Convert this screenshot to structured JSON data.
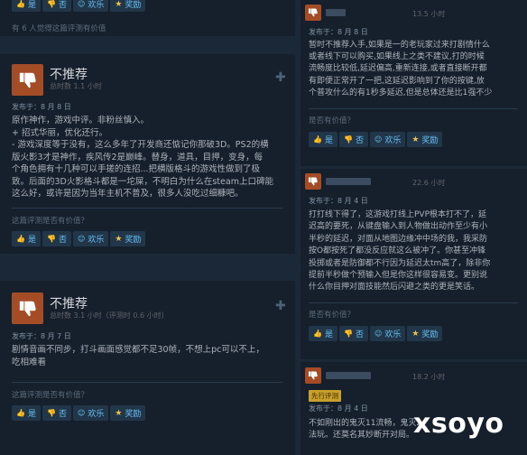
{
  "top_left": {
    "buttons": {
      "yes": "是",
      "no": "否",
      "funny": "欢乐",
      "award": "奖励"
    },
    "helpful_count": "有 6 人觉得这篇评测有价值"
  },
  "review1": {
    "verdict": "不推荐",
    "hours": "总时数 1.1 小时",
    "posted": "发布于：8 月 8 日",
    "lines": [
      "原作神作，游戏中评。非粉丝慎入。",
      "+ 招式华丽，优化还行。",
      "- 游戏深度等于没有，这么多年了开发商还惦记你那破3D。PS2的横",
      "版火影3才是神作，疾风传2是巅峰。替身，道具，目押，变身，每",
      "个角色拥有十几种可以手搓的连招...把横版格斗的游戏性做到了极",
      "致。后面的3D火影格斗都是一坨屎，不明白为什么在steam上口碑能",
      "这么好，或许是因为当年主机不普及，很多人没吃过细糠吧。"
    ],
    "question": "这篇评测是否有价值？",
    "buttons": {
      "yes": "是",
      "no": "否",
      "funny": "欢乐",
      "award": "奖励"
    }
  },
  "review2": {
    "verdict": "不推荐",
    "hours": "总时数 3.1 小时（评测时 0.6 小时）",
    "posted": "发布于：8 月 7 日",
    "lines": [
      "剧情音画不同步，打斗画面感觉都不足30帧，不想上pc可以不上，",
      "吃相难看"
    ],
    "question": "这篇评测是否有价值？",
    "buttons": {
      "yes": "是",
      "no": "否",
      "funny": "欢乐",
      "award": "奖励"
    }
  },
  "rreview1": {
    "hours": "13.5 小时",
    "posted": "发布于：8 月 8 日",
    "lines": [
      "暂时不推荐入手,如果是一的老玩家过来打剧情什么",
      "或者线下可以购买,如果线上之类不建议,打的时候",
      "流畅度比较低,延迟偏高,重新连接,或者直接断开都",
      "有即便正常开了一把,这延迟影响到了你的按键,放",
      "个普攻什么的有1秒多延迟,但是总体还是比1强不少"
    ],
    "question": "是否有价值？",
    "buttons": {
      "yes": "是",
      "no": "否",
      "funny": "欢乐",
      "award": "奖励"
    }
  },
  "rreview2": {
    "hours": "22.6 小时",
    "posted": "发布于：8 月 4 日",
    "lines": [
      "打打线下得了，这游戏打线上PVP根本打不了，延",
      "迟高的要死，从键盘输入到人物做出动作至少有小",
      "半秒的延迟，对面从地图边缘冲中场的我，我采防",
      "按O都按死了都没反应就这么被冲了。你甚至冲锋",
      "投掷或者是防御都不行因为延迟太tm高了，除非你",
      "提前半秒做个预输入但是你这样很容易变。更别说",
      "什么你目押对面技能然后闪避之类的更是笑话。"
    ],
    "question": "是否有价值？",
    "buttons": {
      "yes": "是",
      "no": "否",
      "funny": "欢乐",
      "award": "奖励"
    }
  },
  "rreview3": {
    "hours": "18.2 小时",
    "posted": "发布于：8 月 4 日",
    "tag": "先行评测",
    "lines": [
      "不如刚出的鬼灭11流畅，鬼灭2",
      "法玩。还莫名其妙断开对局。"
    ]
  },
  "watermark": "xsoyo"
}
